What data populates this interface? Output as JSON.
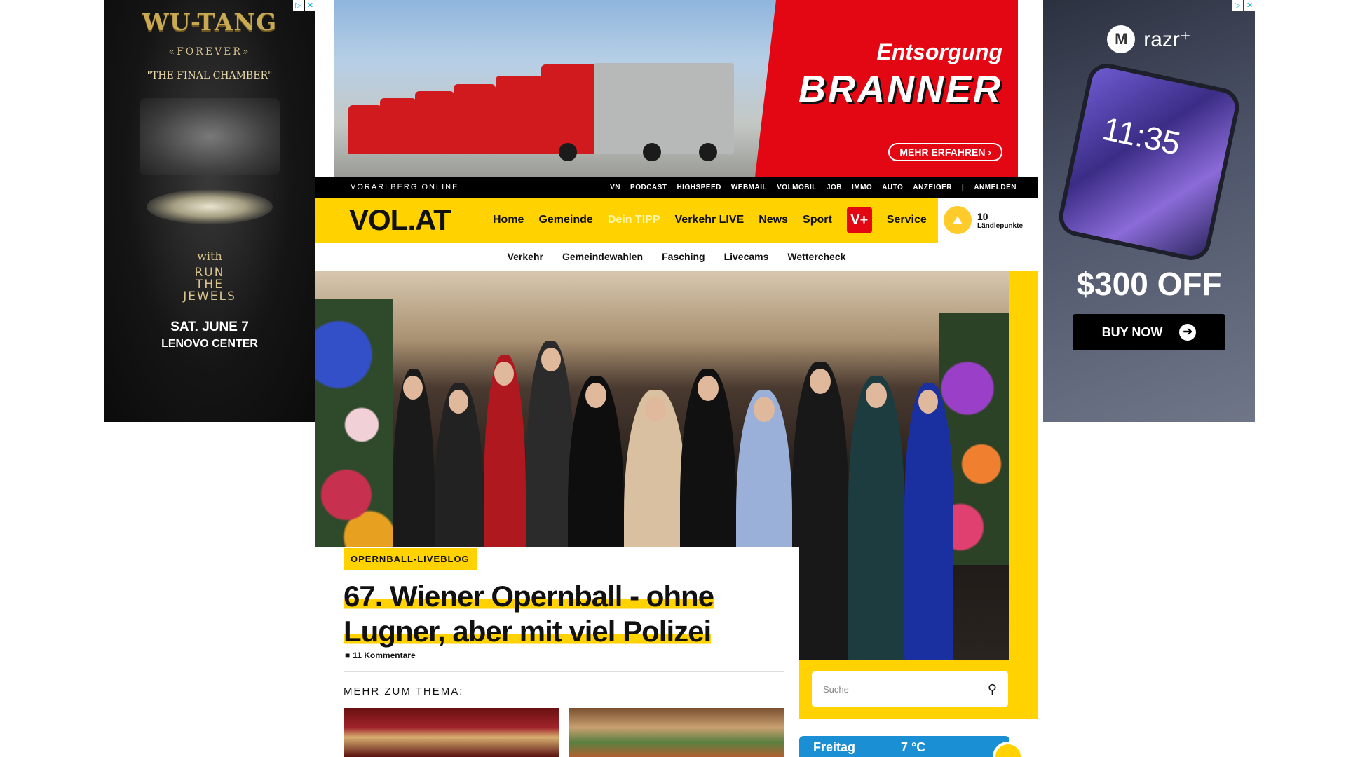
{
  "ads": {
    "left": {
      "logo": "WU-TANG",
      "forever": "«FOREVER»",
      "chamber": "\"THE FINAL CHAMBER\"",
      "with": "with",
      "guest": "RUN\nTHE\nJEWELS",
      "date": "SAT. JUNE 7",
      "venue": "LENOVO CENTER"
    },
    "top": {
      "title": "Entsorgung",
      "brand": "BRANNER",
      "cta": "MEHR ERFAHREN ›"
    },
    "right": {
      "brand": "razr⁺",
      "phone_time": "11:35",
      "offer": "$300 OFF",
      "cta": "BUY NOW"
    }
  },
  "header": {
    "site_tagline": "VORARLBERG ONLINE",
    "top_links": [
      "VN",
      "PODCAST",
      "HIGHSPEED",
      "WEBMAIL",
      "VOLMOBIL",
      "JOB",
      "IMMO",
      "AUTO",
      "ANZEIGER",
      "|",
      "ANMELDEN"
    ],
    "logo": "VOL.AT",
    "nav": [
      "Home",
      "Gemeinde",
      "Dein TIPP",
      "Verkehr LIVE",
      "News",
      "Sport"
    ],
    "vplus": "V+",
    "service": "Service",
    "points_value": "10",
    "points_label": "Ländlepunkte"
  },
  "subnav": [
    "Verkehr",
    "Gemeindewahlen",
    "Fasching",
    "Livecams",
    "Wettercheck"
  ],
  "article": {
    "tag": "OPERNBALL-LIVEBLOG",
    "headline_line1": "67. Wiener Opernball - ohne",
    "headline_line2": "Lugner, aber mit viel Polizei",
    "comments": "11 Kommentare",
    "more_label": "MEHR ZUM THEMA:"
  },
  "sidebar": {
    "search_placeholder": "Suche",
    "weather_day": "Freitag",
    "weather_temp": "7 °C"
  },
  "colors": {
    "brand_yellow": "#ffd200",
    "brand_red": "#e30613",
    "weather_blue": "#1a8fd4"
  }
}
